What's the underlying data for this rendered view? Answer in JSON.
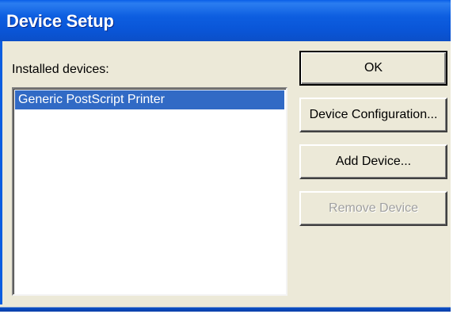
{
  "window": {
    "title": "Device Setup"
  },
  "devices": {
    "label": "Installed devices:",
    "items": [
      {
        "label": "Generic PostScript Printer",
        "selected": true
      }
    ]
  },
  "buttons": {
    "ok": "OK",
    "configure": "Device Configuration...",
    "add": "Add Device...",
    "remove": "Remove Device"
  },
  "colors": {
    "titlebar": "#0a56d8",
    "selection": "#316ac5",
    "dialog_face": "#ece9d8",
    "disabled_text": "#a0a0a0"
  }
}
